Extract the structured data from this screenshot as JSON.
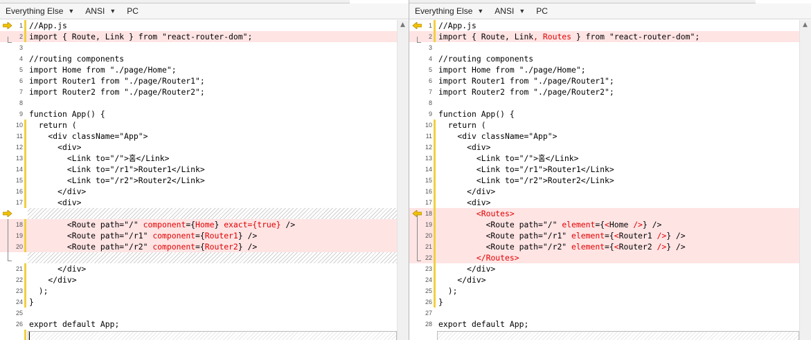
{
  "left_pane": {
    "toolbar": {
      "file_type": "Everything Else",
      "encoding": "ANSI",
      "line_endings": "PC"
    },
    "lines": [
      {
        "row": 0,
        "num": "1",
        "parts": [
          {
            "t": "//App.js"
          }
        ],
        "bar": true,
        "arrow": true
      },
      {
        "row": 1,
        "num": "2",
        "parts": [
          {
            "t": "import { Route, Link } from \"react-router-dom\";"
          }
        ],
        "bar": true,
        "hl": true
      },
      {
        "row": 2,
        "num": "3",
        "parts": [
          {
            "t": ""
          }
        ]
      },
      {
        "row": 3,
        "num": "4",
        "parts": [
          {
            "t": "//routing components"
          }
        ]
      },
      {
        "row": 4,
        "num": "5",
        "parts": [
          {
            "t": "import Home from \"./page/Home\";"
          }
        ]
      },
      {
        "row": 5,
        "num": "6",
        "parts": [
          {
            "t": "import Router1 from \"./page/Router1\";"
          }
        ]
      },
      {
        "row": 6,
        "num": "7",
        "parts": [
          {
            "t": "import Router2 from \"./page/Router2\";"
          }
        ]
      },
      {
        "row": 7,
        "num": "8",
        "parts": [
          {
            "t": ""
          }
        ]
      },
      {
        "row": 8,
        "num": "9",
        "parts": [
          {
            "t": "function App() {"
          }
        ]
      },
      {
        "row": 9,
        "num": "10",
        "parts": [
          {
            "t": "  return ("
          }
        ],
        "bar": true
      },
      {
        "row": 10,
        "num": "11",
        "parts": [
          {
            "t": "    <div className=\"App\">"
          }
        ],
        "bar": true
      },
      {
        "row": 11,
        "num": "12",
        "parts": [
          {
            "t": "      <div>"
          }
        ],
        "bar": true
      },
      {
        "row": 12,
        "num": "13",
        "parts": [
          {
            "t": "        <Link to=\"/\">홈</Link>"
          }
        ],
        "bar": true
      },
      {
        "row": 13,
        "num": "14",
        "parts": [
          {
            "t": "        <Link to=\"/r1\">Router1</Link>"
          }
        ],
        "bar": true
      },
      {
        "row": 14,
        "num": "15",
        "parts": [
          {
            "t": "        <Link to=\"/r2\">Router2</Link>"
          }
        ],
        "bar": true
      },
      {
        "row": 15,
        "num": "16",
        "parts": [
          {
            "t": "      </div>"
          }
        ],
        "bar": true
      },
      {
        "row": 16,
        "num": "17",
        "parts": [
          {
            "t": "      <div>"
          }
        ],
        "bar": true
      },
      {
        "row": 18,
        "num": "18",
        "parts": [
          {
            "t": "        <Route path=\"/\" "
          },
          {
            "t": "component",
            "d": true
          },
          {
            "t": "={"
          },
          {
            "t": "Home",
            "d": true
          },
          {
            "t": "} "
          },
          {
            "t": "exact={true}",
            "d": true
          },
          {
            "t": " />"
          }
        ],
        "bar": true,
        "hl": true
      },
      {
        "row": 19,
        "num": "19",
        "parts": [
          {
            "t": "        <Route path=\"/r1\" "
          },
          {
            "t": "component",
            "d": true
          },
          {
            "t": "={"
          },
          {
            "t": "Router1",
            "d": true
          },
          {
            "t": "} />"
          }
        ],
        "bar": true,
        "hl": true
      },
      {
        "row": 20,
        "num": "20",
        "parts": [
          {
            "t": "        <Route path=\"/r2\" "
          },
          {
            "t": "component",
            "d": true
          },
          {
            "t": "={"
          },
          {
            "t": "Router2",
            "d": true
          },
          {
            "t": "} />"
          }
        ],
        "bar": true,
        "hl": true
      },
      {
        "row": 22,
        "num": "21",
        "parts": [
          {
            "t": "      </div>"
          }
        ],
        "bar": true
      },
      {
        "row": 23,
        "num": "22",
        "parts": [
          {
            "t": "    </div>"
          }
        ],
        "bar": true
      },
      {
        "row": 24,
        "num": "23",
        "parts": [
          {
            "t": "  );"
          }
        ],
        "bar": true
      },
      {
        "row": 25,
        "num": "24",
        "parts": [
          {
            "t": "}"
          }
        ],
        "bar": true
      },
      {
        "row": 26,
        "num": "25",
        "parts": [
          {
            "t": ""
          }
        ]
      },
      {
        "row": 27,
        "num": "26",
        "parts": [
          {
            "t": "export default App;"
          }
        ]
      }
    ]
  },
  "right_pane": {
    "toolbar": {
      "file_type": "Everything Else",
      "encoding": "ANSI",
      "line_endings": "PC"
    },
    "lines": [
      {
        "row": 0,
        "num": "1",
        "parts": [
          {
            "t": "//App.js"
          }
        ],
        "bar": true,
        "arrow": true
      },
      {
        "row": 1,
        "num": "2",
        "parts": [
          {
            "t": "import { Route, Link"
          },
          {
            "t": ", Routes",
            "d": true
          },
          {
            "t": " } from \"react-router-dom\";"
          }
        ],
        "bar": true,
        "hl": true
      },
      {
        "row": 2,
        "num": "3",
        "parts": [
          {
            "t": ""
          }
        ]
      },
      {
        "row": 3,
        "num": "4",
        "parts": [
          {
            "t": "//routing components"
          }
        ]
      },
      {
        "row": 4,
        "num": "5",
        "parts": [
          {
            "t": "import Home from \"./page/Home\";"
          }
        ]
      },
      {
        "row": 5,
        "num": "6",
        "parts": [
          {
            "t": "import Router1 from \"./page/Router1\";"
          }
        ]
      },
      {
        "row": 6,
        "num": "7",
        "parts": [
          {
            "t": "import Router2 from \"./page/Router2\";"
          }
        ]
      },
      {
        "row": 7,
        "num": "8",
        "parts": [
          {
            "t": ""
          }
        ]
      },
      {
        "row": 8,
        "num": "9",
        "parts": [
          {
            "t": "function App() {"
          }
        ]
      },
      {
        "row": 9,
        "num": "10",
        "parts": [
          {
            "t": "  return ("
          }
        ],
        "bar": true
      },
      {
        "row": 10,
        "num": "11",
        "parts": [
          {
            "t": "    <div className=\"App\">"
          }
        ],
        "bar": true
      },
      {
        "row": 11,
        "num": "12",
        "parts": [
          {
            "t": "      <div>"
          }
        ],
        "bar": true
      },
      {
        "row": 12,
        "num": "13",
        "parts": [
          {
            "t": "        <Link to=\"/\">홈</Link>"
          }
        ],
        "bar": true
      },
      {
        "row": 13,
        "num": "14",
        "parts": [
          {
            "t": "        <Link to=\"/r1\">Router1</Link>"
          }
        ],
        "bar": true
      },
      {
        "row": 14,
        "num": "15",
        "parts": [
          {
            "t": "        <Link to=\"/r2\">Router2</Link>"
          }
        ],
        "bar": true
      },
      {
        "row": 15,
        "num": "16",
        "parts": [
          {
            "t": "      </div>"
          }
        ],
        "bar": true
      },
      {
        "row": 16,
        "num": "17",
        "parts": [
          {
            "t": "      <div>"
          }
        ],
        "bar": true
      },
      {
        "row": 17,
        "num": "18",
        "parts": [
          {
            "t": "        "
          },
          {
            "t": "<Routes>",
            "d": true
          }
        ],
        "bar": true,
        "hl": true,
        "arrow": true
      },
      {
        "row": 18,
        "num": "19",
        "parts": [
          {
            "t": "          <Route path=\"/\" "
          },
          {
            "t": "element",
            "d": true
          },
          {
            "t": "={"
          },
          {
            "t": "<",
            "d": true
          },
          {
            "t": "Home "
          },
          {
            "t": "/>",
            "d": true
          },
          {
            "t": "} />"
          }
        ],
        "bar": true,
        "hl": true
      },
      {
        "row": 19,
        "num": "20",
        "parts": [
          {
            "t": "          <Route path=\"/r1\" "
          },
          {
            "t": "element",
            "d": true
          },
          {
            "t": "={"
          },
          {
            "t": "<",
            "d": true
          },
          {
            "t": "Router1 "
          },
          {
            "t": "/>",
            "d": true
          },
          {
            "t": "} />"
          }
        ],
        "bar": true,
        "hl": true
      },
      {
        "row": 20,
        "num": "21",
        "parts": [
          {
            "t": "          <Route path=\"/r2\" "
          },
          {
            "t": "element",
            "d": true
          },
          {
            "t": "={"
          },
          {
            "t": "<",
            "d": true
          },
          {
            "t": "Router2 "
          },
          {
            "t": "/>",
            "d": true
          },
          {
            "t": "} />"
          }
        ],
        "bar": true,
        "hl": true
      },
      {
        "row": 21,
        "num": "22",
        "parts": [
          {
            "t": "        "
          },
          {
            "t": "</Routes>",
            "d": true
          }
        ],
        "bar": true,
        "hl": true
      },
      {
        "row": 22,
        "num": "23",
        "parts": [
          {
            "t": "      </div>"
          }
        ],
        "bar": true
      },
      {
        "row": 23,
        "num": "24",
        "parts": [
          {
            "t": "    </div>"
          }
        ],
        "bar": true
      },
      {
        "row": 24,
        "num": "25",
        "parts": [
          {
            "t": "  );"
          }
        ],
        "bar": true
      },
      {
        "row": 25,
        "num": "26",
        "parts": [
          {
            "t": "}"
          }
        ],
        "bar": true
      },
      {
        "row": 26,
        "num": "27",
        "parts": [
          {
            "t": ""
          }
        ]
      },
      {
        "row": 27,
        "num": "28",
        "parts": [
          {
            "t": "export default App;"
          }
        ]
      }
    ]
  },
  "colors": {
    "diff_text": "#e00000",
    "diff_bg": "#ffe4e4",
    "marker": "#f0d040",
    "arrow": "#f2c200"
  }
}
